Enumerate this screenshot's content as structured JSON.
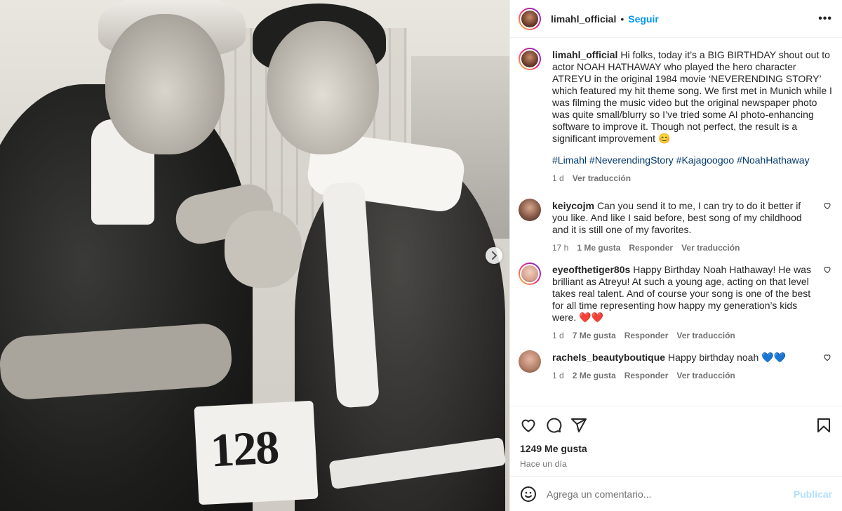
{
  "post": {
    "username": "limahl_official",
    "separator": "•",
    "follow_label": "Seguir",
    "more_label": "•••",
    "image": {
      "bib_number": "128"
    }
  },
  "caption": {
    "username": "limahl_official",
    "text": "Hi folks, today it’s a BIG BIRTHDAY shout out to actor NOAH HATHAWAY who played the hero character ATREYU in the original 1984 movie ‘NEVERENDING STORY’ which featured my hit theme song. We first met in Munich while I was filming the music video but the original newspaper photo was quite small/blurry so I’ve tried some AI photo-enhancing software to improve it. Though not perfect, the result is a significant improvement 😊",
    "hashtags": "#Limahl #NeverendingStory #Kajagoogoo #NoahHathaway",
    "time": "1 d",
    "translate": "Ver traducción"
  },
  "comments": [
    {
      "username": "keiycojm",
      "text": "Can you send it to me, I can try to do it better if you like. And like I said before, best song of my childhood and it is still one of my favorites.",
      "time": "17 h",
      "likes": "1 Me gusta",
      "reply": "Responder",
      "translate": "Ver traducción"
    },
    {
      "username": "eyeofthetiger80s",
      "text": "Happy Birthday Noah Hathaway! He was brilliant as Atreyu! At such a young age, acting on that level takes real talent. And of course your song is one of the best for all time representing how happy my generation’s kids were. ❤️❤️",
      "time": "1 d",
      "likes": "7 Me gusta",
      "reply": "Responder",
      "translate": "Ver traducción"
    },
    {
      "username": "rachels_beautyboutique",
      "text": "Happy birthday noah 💙💙",
      "time": "1 d",
      "likes": "2 Me gusta",
      "reply": "Responder",
      "translate": "Ver traducción"
    }
  ],
  "actions": {
    "likes": "1249 Me gusta",
    "posted": "Hace un día",
    "icons": [
      "heart-icon",
      "comment-icon",
      "share-icon",
      "bookmark-icon"
    ]
  },
  "comment_box": {
    "placeholder": "Agrega un comentario...",
    "publish_label": "Publicar"
  },
  "colors": {
    "link": "#0095f6",
    "hashtag": "#00376b",
    "muted": "#737373",
    "publish_disabled": "#b2dffc"
  }
}
